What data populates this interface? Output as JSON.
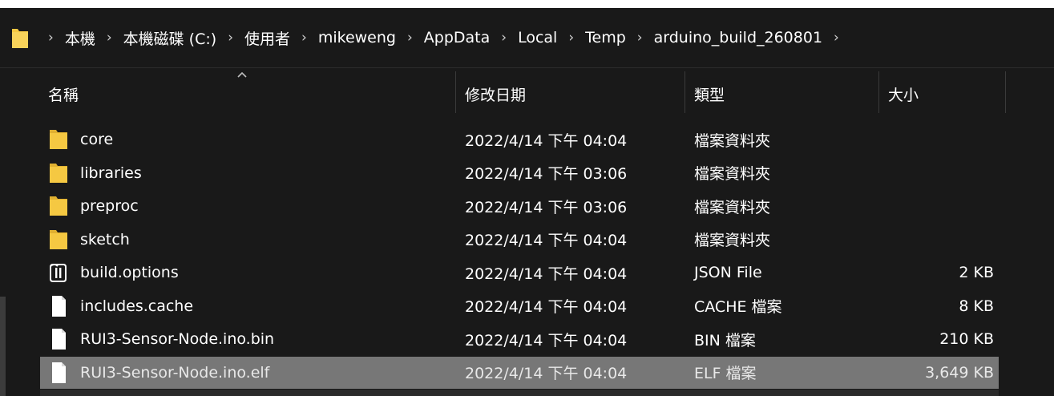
{
  "breadcrumb": [
    "本機",
    "本機磁碟 (C:)",
    "使用者",
    "mikeweng",
    "AppData",
    "Local",
    "Temp",
    "arduino_build_260801"
  ],
  "columns": {
    "name": "名稱",
    "modified": "修改日期",
    "type": "類型",
    "size": "大小"
  },
  "files": [
    {
      "name": "core",
      "modified": "2022/4/14 下午 04:04",
      "type": "檔案資料夾",
      "size": "",
      "icon": "folder-icon"
    },
    {
      "name": "libraries",
      "modified": "2022/4/14 下午 03:06",
      "type": "檔案資料夾",
      "size": "",
      "icon": "folder-icon"
    },
    {
      "name": "preproc",
      "modified": "2022/4/14 下午 03:06",
      "type": "檔案資料夾",
      "size": "",
      "icon": "folder-icon"
    },
    {
      "name": "sketch",
      "modified": "2022/4/14 下午 04:04",
      "type": "檔案資料夾",
      "size": "",
      "icon": "folder-icon"
    },
    {
      "name": "build.options",
      "modified": "2022/4/14 下午 04:04",
      "type": "JSON File",
      "size": "2 KB",
      "icon": "json-file-icon"
    },
    {
      "name": "includes.cache",
      "modified": "2022/4/14 下午 04:04",
      "type": "CACHE 檔案",
      "size": "8 KB",
      "icon": "file-icon"
    },
    {
      "name": "RUI3-Sensor-Node.ino.bin",
      "modified": "2022/4/14 下午 04:04",
      "type": "BIN 檔案",
      "size": "210 KB",
      "icon": "file-icon"
    },
    {
      "name": "RUI3-Sensor-Node.ino.elf",
      "modified": "2022/4/14 下午 04:04",
      "type": "ELF 檔案",
      "size": "3,649 KB",
      "icon": "file-icon",
      "selected": true
    }
  ],
  "colors": {
    "background": "#191919",
    "folder": "#f5c842",
    "selection": "#777777"
  }
}
